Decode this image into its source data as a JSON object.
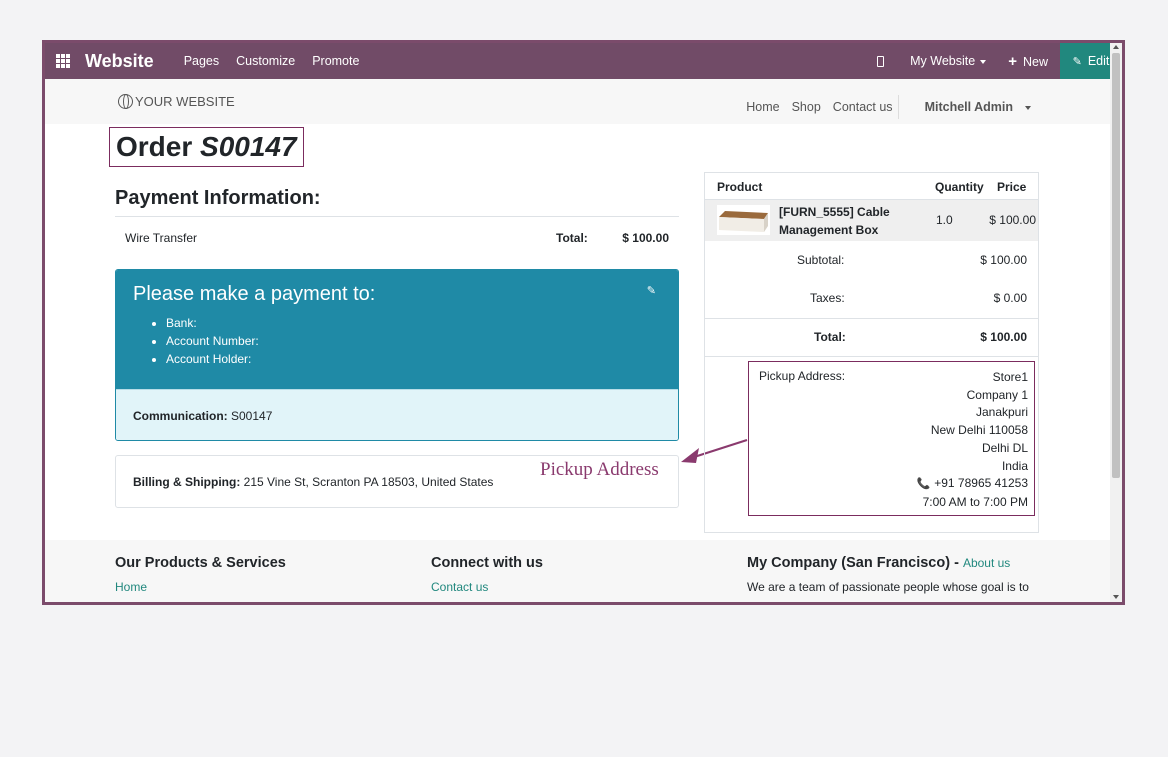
{
  "topbar": {
    "brand": "Website",
    "menu": [
      "Pages",
      "Customize",
      "Promote"
    ],
    "site_selector": "My Website",
    "new_label": "New",
    "edit_label": "Edit"
  },
  "site_header": {
    "logo_text": "YOUR WEBSITE",
    "nav": [
      "Home",
      "Shop",
      "Contact us"
    ],
    "user": "Mitchell Admin"
  },
  "order": {
    "title_prefix": "Order ",
    "number": "S00147"
  },
  "payment": {
    "heading": "Payment Information:",
    "method": "Wire Transfer",
    "total_label": "Total:",
    "total_value": "$ 100.00",
    "instructions_title": "Please make a payment to:",
    "instructions": [
      "Bank:",
      "Account Number:",
      "Account Holder:"
    ],
    "communication_label": "Communication:",
    "communication_value": " S00147",
    "billing_label": "Billing & Shipping:",
    "billing_value": " 215 Vine St, Scranton PA 18503, United States"
  },
  "annotation": {
    "text": "Pickup Address",
    "color": "#8a3a6e"
  },
  "summary": {
    "headers": [
      "Product",
      "Quantity",
      "Price"
    ],
    "product": {
      "name_line1": "[FURN_5555] Cable",
      "name_line2": "Management Box",
      "quantity": "1.0",
      "price": "$ 100.00"
    },
    "subtotal_label": "Subtotal:",
    "subtotal_value": "$ 100.00",
    "taxes_label": "Taxes:",
    "taxes_value": "$ 0.00",
    "total_label": "Total:",
    "total_value": "$ 100.00"
  },
  "pickup": {
    "label": "Pickup Address:",
    "lines": [
      "Store1",
      "Company 1",
      "Janakpuri",
      "New Delhi 110058",
      "Delhi DL",
      "India"
    ],
    "phone": "+91 78965 41253",
    "hours": "7:00 AM to 7:00 PM"
  },
  "footer": {
    "col1_title": "Our Products & Services",
    "col1_link": "Home",
    "col2_title": "Connect with us",
    "col2_link": "Contact us",
    "col3_title": "My Company (San Francisco)",
    "col3_link": "About us",
    "col3_text": "We are a team of passionate people whose goal is to"
  },
  "colors": {
    "brand": "#714b67",
    "edit": "#21887e",
    "payment_box": "#1f8aa6",
    "highlight_border": "#7b2c5e"
  }
}
